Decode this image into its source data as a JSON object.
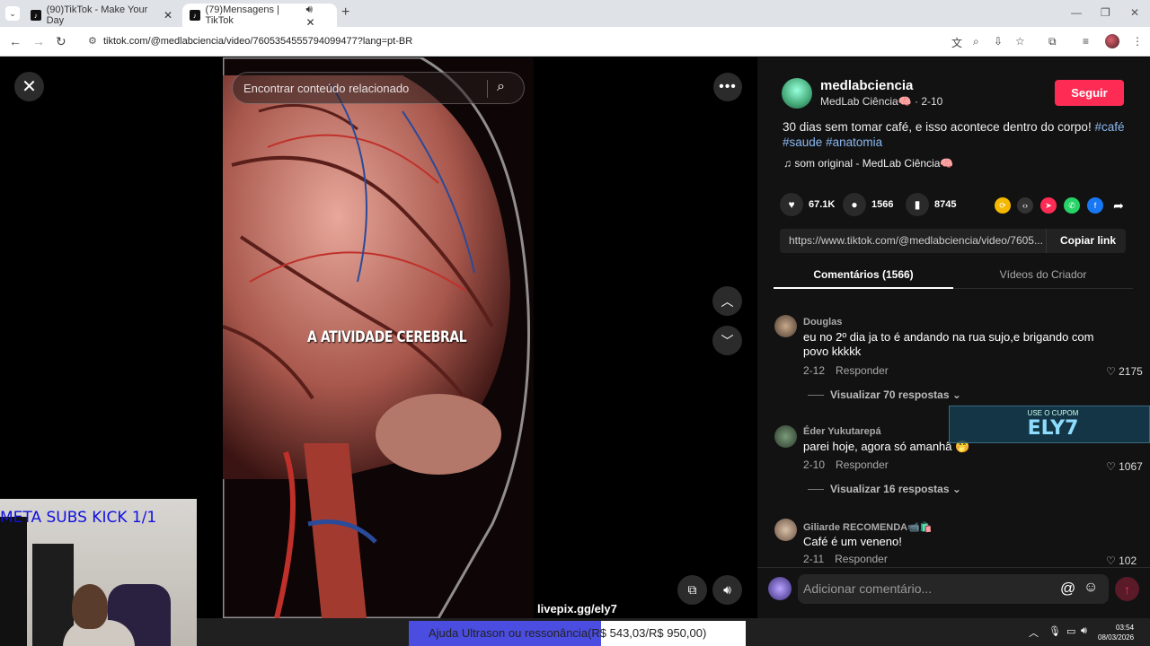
{
  "browser": {
    "tabs": [
      {
        "title": "(90)TikTok - Make Your Day"
      },
      {
        "title": "(79)Mensagens | TikTok"
      }
    ],
    "url": "tiktok.com/@medlabciencia/video/7605354555794099477?lang=pt-BR"
  },
  "viewer": {
    "search_placeholder": "Encontrar conteúdo relacionado",
    "caption": "A ATIVIDADE CEREBRAL"
  },
  "author": {
    "username": "medlabciencia",
    "nickname": "MedLab Ciência🧠 · 2-10",
    "follow_label": "Seguir"
  },
  "post": {
    "description": "30 dias sem tomar café, e isso acontece dentro do corpo!",
    "tags": [
      "#café",
      "#saude",
      "#anatomia"
    ],
    "music": "som original - MedLab Ciência🧠",
    "likes": "67.1K",
    "comments": "1566",
    "saves": "8745",
    "link": "https://www.tiktok.com/@medlabciencia/video/7605...",
    "copy_label": "Copiar link"
  },
  "tabs": {
    "comments": "Comentários (1566)",
    "videos": "Vídeos do Criador"
  },
  "comments": [
    {
      "name": "Douglas",
      "text": "eu no 2º dia ja to é andando na rua sujo,e brigando com povo kkkkk",
      "date": "2-12",
      "reply": "Responder",
      "likes": "2175",
      "replies": "Visualizar 70 respostas"
    },
    {
      "name": "Éder Yukutarepá",
      "text": "parei hoje, agora só amanhã 🤭",
      "date": "2-10",
      "reply": "Responder",
      "likes": "1067",
      "replies": "Visualizar 16 respostas"
    },
    {
      "name": "Giliarde RECOMENDA📹🛍️",
      "text": "Café é um veneno!",
      "date": "2-11",
      "reply": "Responder",
      "likes": "102"
    }
  ],
  "comment_input": {
    "placeholder": "Adicionar comentário..."
  },
  "stream": {
    "meta_subs": "META SUBS KICK 1/1",
    "livepix": "livepix.gg/ely7",
    "coupon_top": "USE O CUPOM",
    "coupon_code": "ELY7",
    "donation_text": "Ajuda Ultrason ou ressonância",
    "donation_goal": "(R$ 543,03/R$ 950,00)",
    "donation_progress": 0.5716
  },
  "taskbar": {
    "time": "03:54",
    "date": "08/03/2026"
  }
}
